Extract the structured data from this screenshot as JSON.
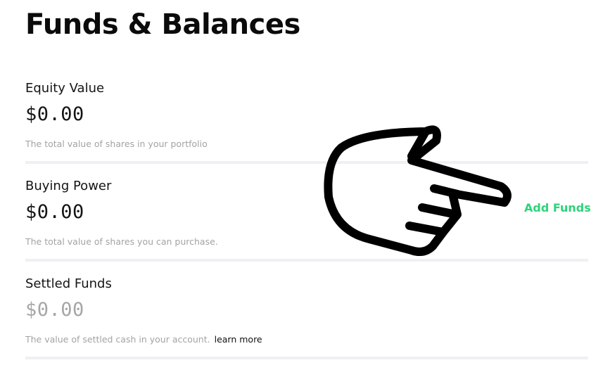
{
  "page": {
    "title": "Funds & Balances"
  },
  "sections": [
    {
      "label": "Equity Value",
      "amount": "$0.00",
      "description": "The total value of shares in your portfolio"
    },
    {
      "label": "Buying Power",
      "amount": "$0.00",
      "description": "The total value of shares you can purchase.",
      "action_label": "Add Funds"
    },
    {
      "label": "Settled Funds",
      "amount": "$0.00",
      "description": "The value of settled cash in your account.",
      "link_label": "learn more"
    }
  ],
  "overlay": {
    "icon": "pointing-hand-icon"
  },
  "colors": {
    "accent": "#2dd47a",
    "muted_text": "#a3a3a3",
    "divider": "#eef0f4"
  }
}
